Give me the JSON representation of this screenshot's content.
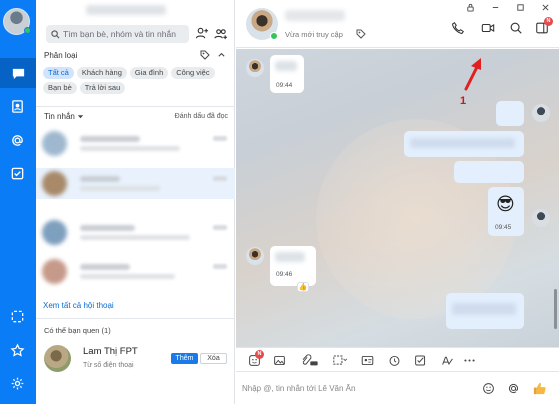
{
  "search": {
    "placeholder": "Tìm bạn bè, nhóm và tin nhắn"
  },
  "filters": {
    "title": "Phân loại",
    "tags": [
      "Tất cả",
      "Khách hàng",
      "Gia đình",
      "Công việc",
      "Bạn bè",
      "Trả lời sau"
    ],
    "active_index": 0
  },
  "messages_section": {
    "title": "Tin nhắn",
    "mark_read": "Đánh dấu đã đọc"
  },
  "see_all": "Xem tất cả hội thoại",
  "suggestions": {
    "title": "Có thể bạn quen (1)",
    "name": "Lam Thị FPT",
    "subtitle": "Từ số điện thoại",
    "add_label": "Thêm",
    "skip_label": "Xóa"
  },
  "chat": {
    "status": "Vừa mới truy cập",
    "messages": [
      {
        "side": "in",
        "time": "09:44"
      },
      {
        "side": "out",
        "emoji": "😎",
        "time": "09:45"
      },
      {
        "side": "in",
        "time": "09:46",
        "reaction": "👍"
      }
    ],
    "composer_placeholder": "Nhập @, tin nhắn tới Lê Văn Ấn",
    "toolbar_badge": "N",
    "window_badge": "N",
    "annotation_marker": "1"
  },
  "colors": {
    "rail": "#0a7cf5",
    "accent": "#1a7ae8",
    "online": "#37c55a",
    "arrow": "#e02020"
  }
}
